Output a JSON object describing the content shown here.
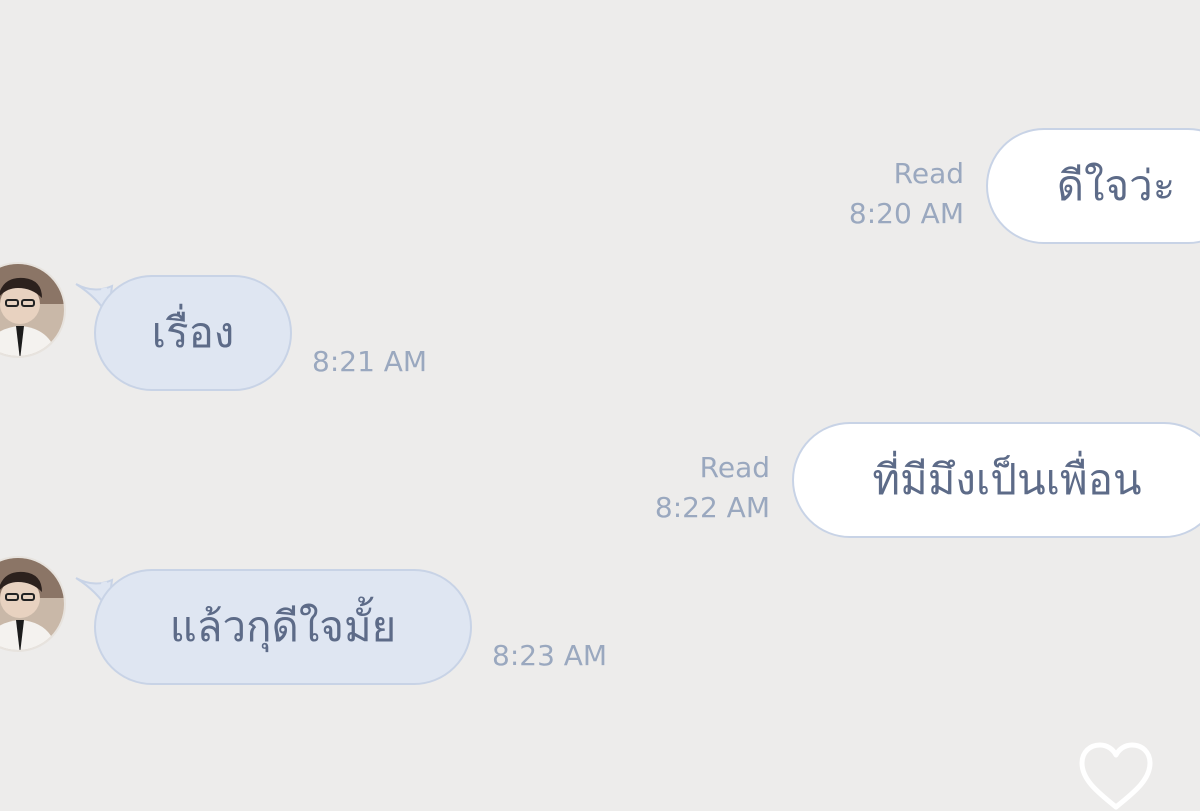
{
  "messages": [
    {
      "direction": "outgoing",
      "text": "ดีใจว่ะ",
      "status": "Read",
      "time": "8:20 AM"
    },
    {
      "direction": "incoming",
      "text": "เรื่อง",
      "time": "8:21 AM"
    },
    {
      "direction": "outgoing",
      "text": "ที่มีมึงเป็นเพื่อน",
      "status": "Read",
      "time": "8:22 AM"
    },
    {
      "direction": "incoming",
      "text": "แล้วกุดีใจมั้ย",
      "time": "8:23 AM"
    }
  ],
  "icons": {
    "like": "heart-outline-icon"
  },
  "colors": {
    "background": "#edeceb",
    "outgoing_bubble": "#ffffff",
    "incoming_bubble": "#dfe6f2",
    "bubble_border": "#c8d3e6",
    "text": "#5d6b88",
    "meta_text": "#9aa8bf"
  }
}
